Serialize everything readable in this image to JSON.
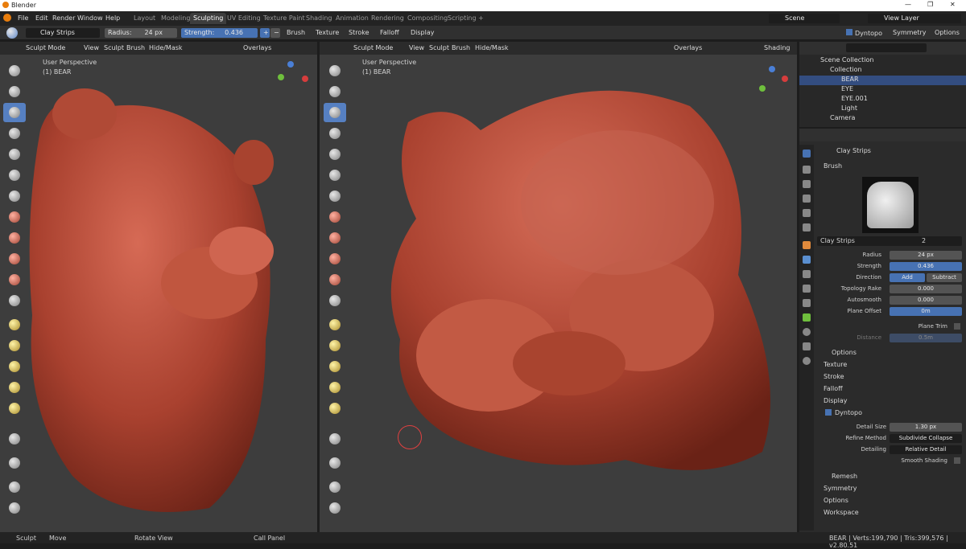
{
  "titlebar": {
    "title": "Blender",
    "controls": [
      "—",
      "❐",
      "✕"
    ]
  },
  "menu": [
    "File",
    "Edit",
    "Render",
    "Window",
    "Help"
  ],
  "workspaces": [
    "Layout",
    "Modeling",
    "Sculpting",
    "UV Editing",
    "Texture Paint",
    "Shading",
    "Animation",
    "Rendering",
    "Compositing",
    "Scripting",
    "+"
  ],
  "active_workspace": "Sculpting",
  "scene": "Scene",
  "view_layer": "View Layer",
  "toolhdr": {
    "brush": "Clay Strips",
    "radius_label": "Radius:",
    "radius": "24 px",
    "strength_label": "Strength:",
    "strength": "0.436",
    "menus": [
      "Brush",
      "Texture",
      "Stroke",
      "Falloff",
      "Display"
    ],
    "dyntopo": "Dyntopo",
    "symmetry": "Symmetry",
    "options": "Options"
  },
  "viewport": {
    "mode": "Sculpt Mode",
    "menus": [
      "View",
      "Sculpt",
      "Brush",
      "Hide/Mask"
    ],
    "overlays": "Overlays",
    "shading": "Shading",
    "persp": "User Perspective",
    "object": "(1) BEAR"
  },
  "outliner": {
    "rows": [
      "Scene Collection",
      "Collection",
      "BEAR",
      "EYE",
      "EYE.001",
      "Light",
      "Camera"
    ]
  },
  "props": {
    "brush_name": "Clay Strips",
    "section": "Brush",
    "brush_field": "Clay Strips",
    "users": "2",
    "radius_l": "Radius",
    "radius": "24 px",
    "strength_l": "Strength",
    "strength": "0.436",
    "direction_l": "Direction",
    "add": "Add",
    "subtract": "Subtract",
    "topo_l": "Topology Rake",
    "topo": "0.000",
    "auto_l": "Autosmooth",
    "auto": "0.000",
    "plane_l": "Plane Offset",
    "plane": "0m",
    "trim_l": "Plane Trim",
    "dist_l": "Distance",
    "dist": "0.5m",
    "options": "Options",
    "texture": "Texture",
    "stroke": "Stroke",
    "falloff": "Falloff",
    "display": "Display",
    "dyntopo": "Dyntopo",
    "detail_size_l": "Detail Size",
    "detail_size": "1.30 px",
    "refine_l": "Refine Method",
    "refine": "Subdivide Collapse",
    "detailing_l": "Detailing",
    "detailing": "Relative Detail",
    "smooth_l": "Smooth Shading",
    "remesh": "Remesh",
    "symmetry": "Symmetry",
    "options2": "Options",
    "workspace": "Workspace"
  },
  "status": {
    "sculpt": "Sculpt",
    "move": "Move",
    "rotate": "Rotate View",
    "call": "Call Panel",
    "stats": "BEAR | Verts:199,790 | Tris:399,576 | v2.80.51"
  }
}
